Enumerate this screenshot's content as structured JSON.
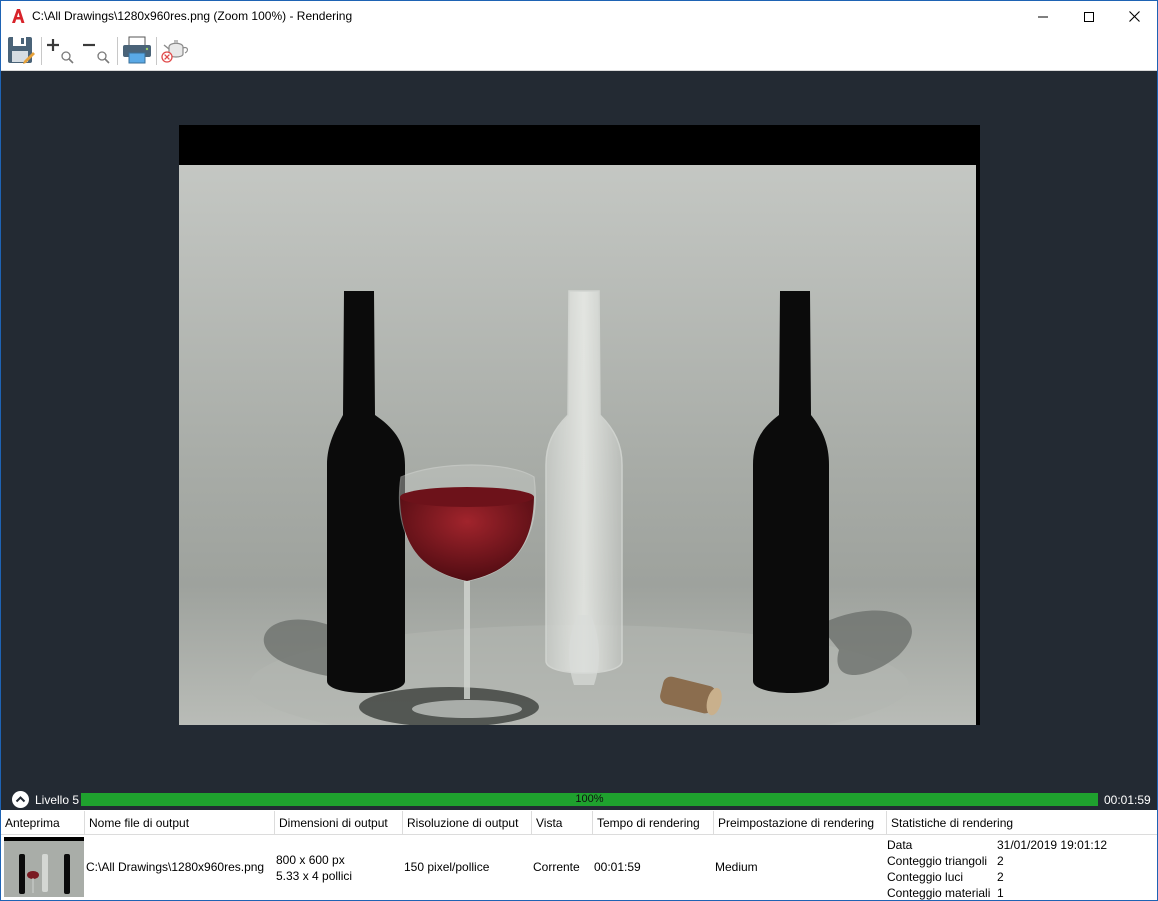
{
  "window": {
    "title": "C:\\All Drawings\\1280x960res.png (Zoom 100%) - Rendering",
    "app_icon": "autocad-a-icon",
    "accent_color": "#1e63b4"
  },
  "toolbar": {
    "icons": [
      "save-icon",
      "zoom-in-icon",
      "zoom-out-icon",
      "print-icon",
      "teapot-delete-icon"
    ]
  },
  "progress": {
    "level_label": "Livello 5",
    "percent_text": "100%",
    "percent_value": 100,
    "elapsed": "00:01:59",
    "bar_color": "#1fa12e"
  },
  "table": {
    "columns": [
      "Anteprima",
      "Nome file di output",
      "Dimensioni di output",
      "Risoluzione di output",
      "Vista",
      "Tempo di rendering",
      "Preimpostazione di rendering",
      "Statistiche di rendering"
    ],
    "row": {
      "file_name": "C:\\All Drawings\\1280x960res.png",
      "dimensions_px": "800 x 600 px",
      "dimensions_in": "5.33 x 4 pollici",
      "resolution": "150 pixel/pollice",
      "view": "Corrente",
      "render_time": "00:01:59",
      "preset": "Medium",
      "stats": [
        {
          "name": "Data",
          "value": "31/01/2019 19:01:12"
        },
        {
          "name": "Conteggio triangoli",
          "value": "2"
        },
        {
          "name": "Conteggio luci",
          "value": "2"
        },
        {
          "name": "Conteggio materiali",
          "value": "1"
        }
      ]
    }
  }
}
